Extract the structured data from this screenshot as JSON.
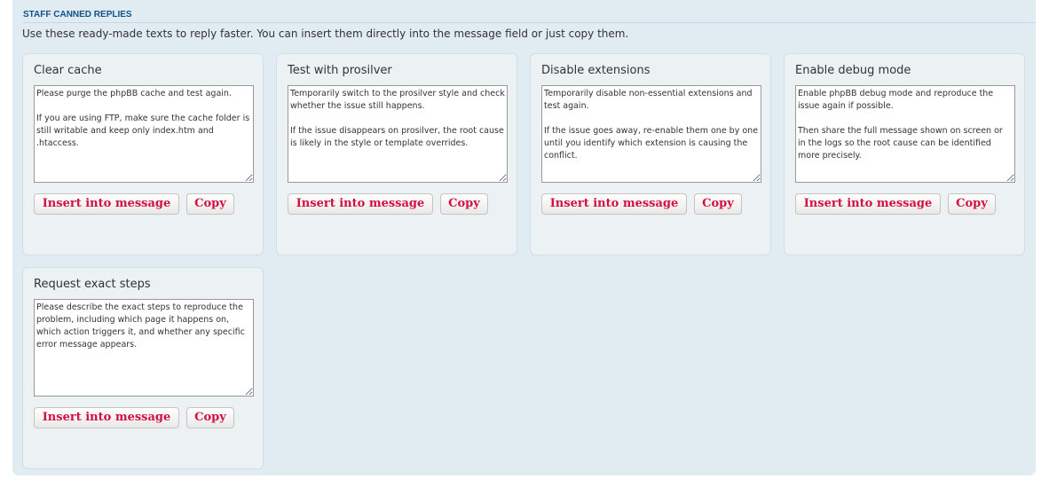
{
  "panel": {
    "title": "STAFF CANNED REPLIES",
    "description": "Use these ready-made texts to reply faster. You can insert them directly into the message field or just copy them."
  },
  "replies": [
    {
      "title": "Clear cache",
      "text": "Please purge the phpBB cache and test again.\n\nIf you are using FTP, make sure the cache folder is still writable and keep only index.htm and .htaccess.",
      "insert_label": "Insert into message",
      "copy_label": "Copy"
    },
    {
      "title": "Test with prosilver",
      "text": "Temporarily switch to the prosilver style and check whether the issue still happens.\n\nIf the issue disappears on prosilver, the root cause is likely in the style or template overrides.",
      "insert_label": "Insert into message",
      "copy_label": "Copy"
    },
    {
      "title": "Disable extensions",
      "text": "Temporarily disable non-essential extensions and test again.\n\nIf the issue goes away, re-enable them one by one until you identify which extension is causing the conflict.",
      "insert_label": "Insert into message",
      "copy_label": "Copy"
    },
    {
      "title": "Enable debug mode",
      "text": "Enable phpBB debug mode and reproduce the issue again if possible.\n\nThen share the full message shown on screen or in the logs so the root cause can be identified more precisely.",
      "insert_label": "Insert into message",
      "copy_label": "Copy"
    },
    {
      "title": "Request exact steps",
      "text": "Please describe the exact steps to reproduce the problem, including which page it happens on, which action triggers it, and whether any specific error message appears.",
      "insert_label": "Insert into message",
      "copy_label": "Copy"
    }
  ]
}
